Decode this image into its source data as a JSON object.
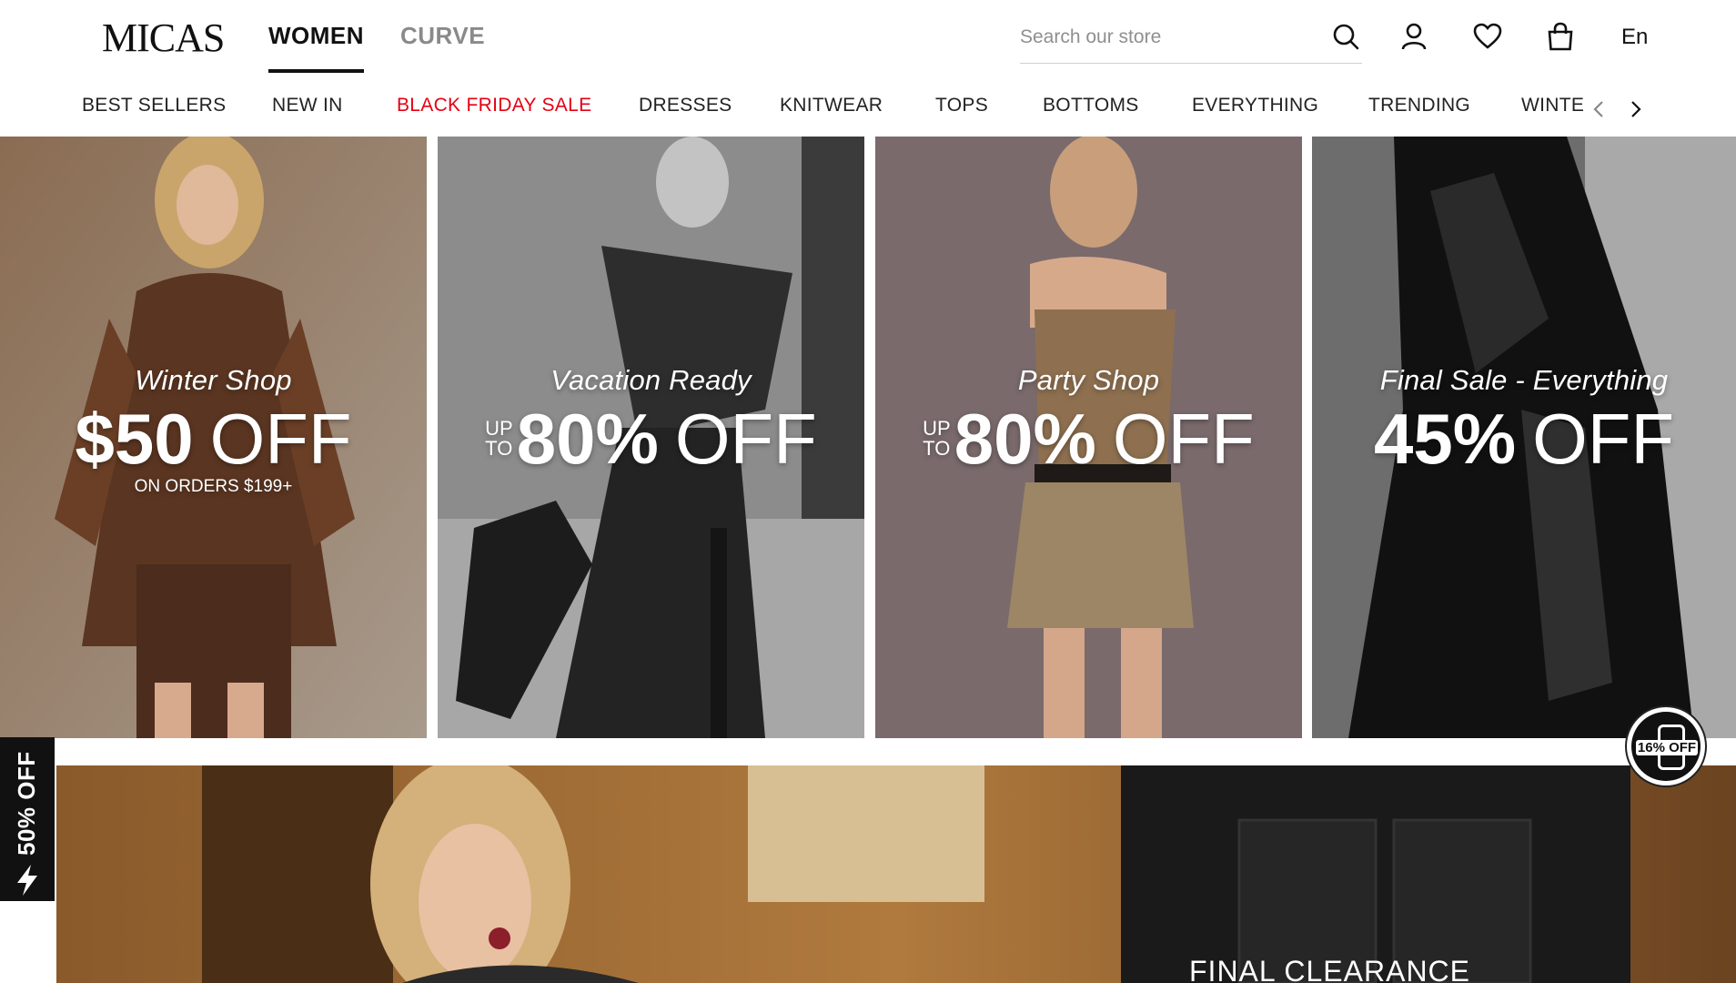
{
  "brand": {
    "logo": "MICAS"
  },
  "gender_tabs": [
    {
      "label": "WOMEN",
      "active": true
    },
    {
      "label": "CURVE",
      "active": false
    }
  ],
  "search": {
    "placeholder": "Search our store",
    "value": ""
  },
  "header_icons": [
    "search-icon",
    "user-icon",
    "heart-icon",
    "shopping-bag-icon"
  ],
  "language": "En",
  "categories": [
    {
      "label": "BEST SELLERS"
    },
    {
      "label": "NEW IN"
    },
    {
      "label": "BLACK FRIDAY SALE",
      "highlight": true
    },
    {
      "label": "DRESSES"
    },
    {
      "label": "KNITWEAR"
    },
    {
      "label": "TOPS"
    },
    {
      "label": "BOTTOMS"
    },
    {
      "label": "EVERYTHING"
    },
    {
      "label": "TRENDING"
    },
    {
      "label": "WINTER"
    }
  ],
  "promos": [
    {
      "title": "Winter Shop",
      "amount": "$50",
      "off": "OFF",
      "note": "ON ORDERS $199+",
      "theme": "brown"
    },
    {
      "title": "Vacation Ready",
      "prefix_top": "UP",
      "prefix_bottom": "TO",
      "amount": "80%",
      "off": "OFF",
      "theme": "mono"
    },
    {
      "title": "Party Shop",
      "prefix_top": "UP",
      "prefix_bottom": "TO",
      "amount": "80%",
      "off": "OFF",
      "theme": "mauve"
    },
    {
      "title": "Final Sale - Everything",
      "amount": "45%",
      "off": "OFF",
      "theme": "dark"
    }
  ],
  "hero": {
    "title": "FINAL CLEARANCE"
  },
  "side_tab": {
    "label": "50% OFF",
    "icon": "lightning-icon"
  },
  "app_badge": {
    "label": "16% OFF",
    "icon": "phone-icon"
  },
  "colors": {
    "sale_red": "#e60012",
    "text": "#111111",
    "muted": "#8a8a8a"
  }
}
